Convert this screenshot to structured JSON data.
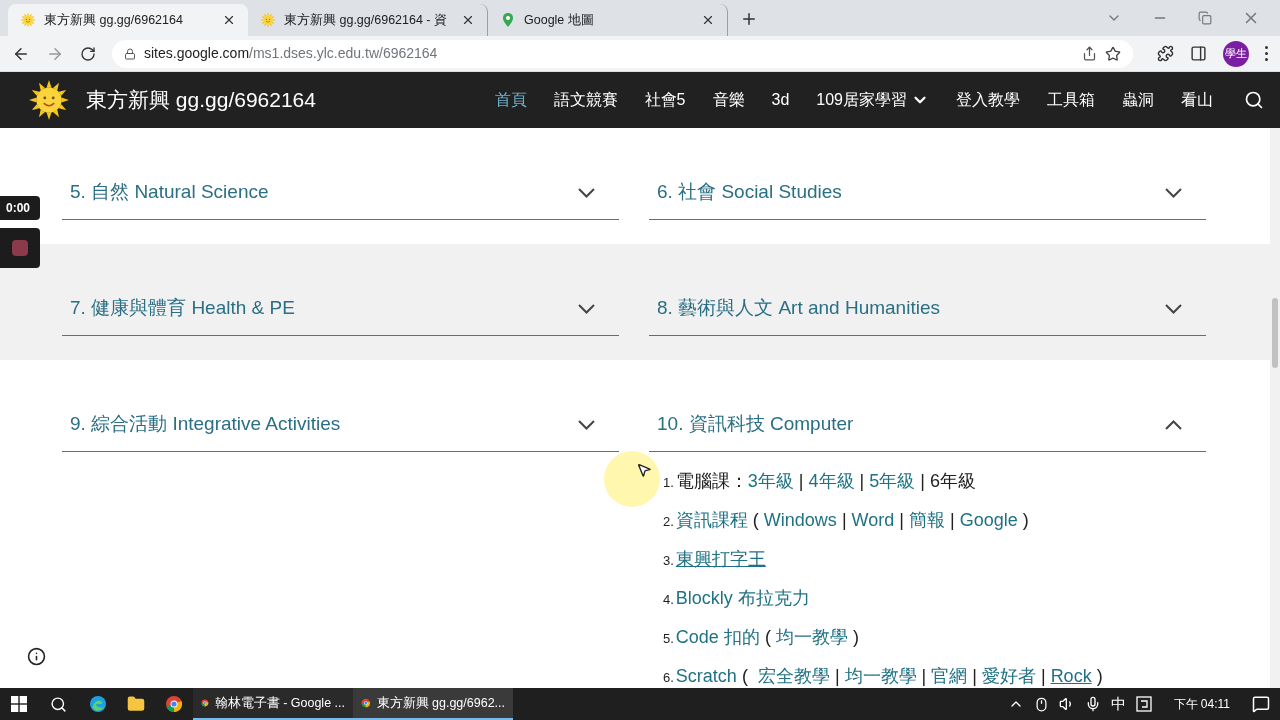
{
  "browser": {
    "tabs": [
      {
        "title": "東方新興 gg.gg/6962164",
        "selected": true,
        "kind": "sun"
      },
      {
        "title": "東方新興 gg.gg/6962164 - 資",
        "selected": false,
        "kind": "sun"
      },
      {
        "title": "Google 地圖",
        "selected": false,
        "kind": "pin"
      }
    ],
    "url_host": "sites.google.com",
    "url_path": "/ms1.dses.ylc.edu.tw/6962164",
    "profile": "學生"
  },
  "site": {
    "title": "東方新興 gg.gg/6962164",
    "nav": [
      {
        "label": "首頁",
        "selected": true,
        "kind": "link"
      },
      {
        "label": "語文競賽",
        "selected": false,
        "kind": "link"
      },
      {
        "label": "社會5",
        "selected": false,
        "kind": "link"
      },
      {
        "label": "音樂",
        "selected": false,
        "kind": "link"
      },
      {
        "label": "3d",
        "selected": false,
        "kind": "link"
      },
      {
        "label": "109居家學習",
        "selected": false,
        "kind": "dropdown"
      },
      {
        "label": "登入教學",
        "selected": false,
        "kind": "link"
      },
      {
        "label": "工具箱",
        "selected": false,
        "kind": "link"
      },
      {
        "label": "蟲洞",
        "selected": false,
        "kind": "link"
      },
      {
        "label": "看山",
        "selected": false,
        "kind": "link"
      }
    ]
  },
  "recorder": {
    "time": "0:00"
  },
  "sections": [
    {
      "title": "5. 自然 Natural Science",
      "expanded": false
    },
    {
      "title": "6. 社會 Social Studies",
      "expanded": false
    },
    {
      "title": "7. 健康與體育 Health & PE",
      "expanded": false
    },
    {
      "title": "8. 藝術與人文 Art and Humanities",
      "expanded": false
    },
    {
      "title": "9. 綜合活動 Integrative Activities",
      "expanded": false
    },
    {
      "title": "10. 資訊科技 Computer",
      "expanded": true,
      "items": [
        {
          "number": "1.",
          "parts": [
            {
              "text": "電腦課：",
              "kind": "plain"
            },
            {
              "text": "3年級",
              "kind": "link"
            },
            {
              "text": " | ",
              "kind": "plain"
            },
            {
              "text": "4年級",
              "kind": "link"
            },
            {
              "text": " | ",
              "kind": "plain"
            },
            {
              "text": "5年級",
              "kind": "link"
            },
            {
              "text": " | ",
              "kind": "plain"
            },
            {
              "text": "6年級",
              "kind": "plain"
            }
          ]
        },
        {
          "number": "2.",
          "parts": [
            {
              "text": "資訊課程",
              "kind": "link"
            },
            {
              "text": " ( ",
              "kind": "plain"
            },
            {
              "text": "Windows",
              "kind": "link"
            },
            {
              "text": " | ",
              "kind": "plain"
            },
            {
              "text": "Word",
              "kind": "link"
            },
            {
              "text": " | ",
              "kind": "plain"
            },
            {
              "text": "簡報",
              "kind": "link"
            },
            {
              "text": " | ",
              "kind": "plain"
            },
            {
              "text": "Google",
              "kind": "link"
            },
            {
              "text": " )",
              "kind": "plain"
            }
          ]
        },
        {
          "number": "3.",
          "parts": [
            {
              "text": "東興打字王",
              "kind": "underlined"
            }
          ]
        },
        {
          "number": "4.",
          "parts": [
            {
              "text": "Blockly 布拉克力",
              "kind": "link"
            }
          ]
        },
        {
          "number": "5.",
          "parts": [
            {
              "text": "Code 扣的",
              "kind": "link"
            },
            {
              "text": " ( ",
              "kind": "plain"
            },
            {
              "text": "均一教學",
              "kind": "link"
            },
            {
              "text": " )",
              "kind": "plain"
            }
          ]
        },
        {
          "number": "6.",
          "parts": [
            {
              "text": "Scratch",
              "kind": "link"
            },
            {
              "text": " (  ",
              "kind": "plain"
            },
            {
              "text": "宏全教學",
              "kind": "link"
            },
            {
              "text": " | ",
              "kind": "plain"
            },
            {
              "text": "均一教學",
              "kind": "link"
            },
            {
              "text": " | ",
              "kind": "plain"
            },
            {
              "text": "官網",
              "kind": "link"
            },
            {
              "text": " | ",
              "kind": "plain"
            },
            {
              "text": "愛好者",
              "kind": "link"
            },
            {
              "text": " | ",
              "kind": "plain"
            },
            {
              "text": "Rock",
              "kind": "underlined"
            },
            {
              "text": " )",
              "kind": "plain"
            }
          ]
        }
      ]
    }
  ],
  "taskbar": {
    "tasks": [
      {
        "label": "翰林電子書 - Google ...",
        "selected": false
      },
      {
        "label": "東方新興 gg.gg/6962...",
        "selected": true
      }
    ],
    "ime": "中",
    "clock": "下午 04:11"
  }
}
